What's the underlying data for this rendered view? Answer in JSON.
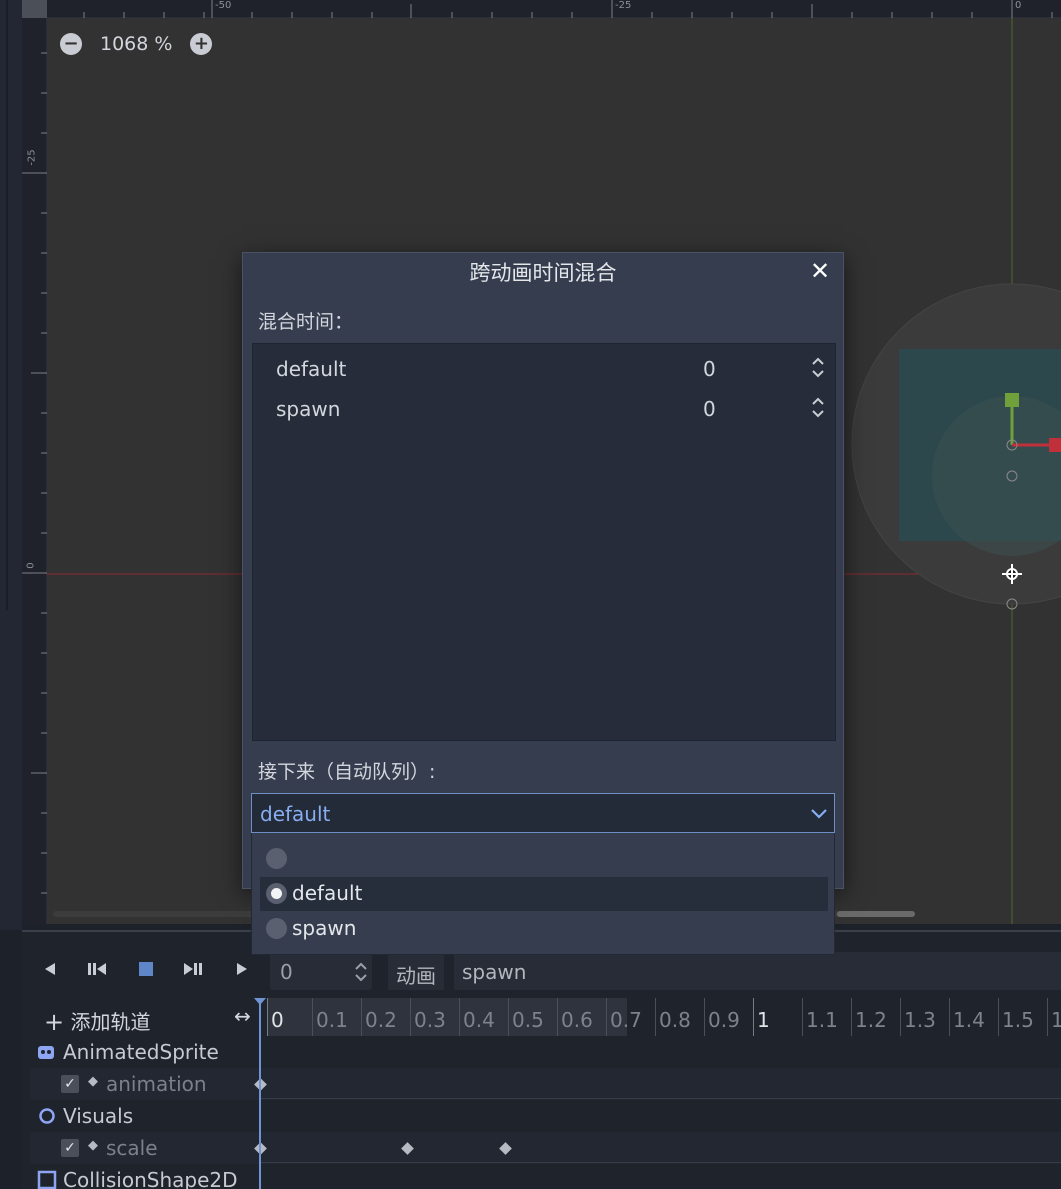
{
  "viewport": {
    "zoom_out_symbol": "−",
    "zoom_level": "1068 %",
    "zoom_in_symbol": "+",
    "ruler_top_labels": [
      "-50",
      "-25",
      "0"
    ],
    "ruler_left_labels": [
      "-25",
      "0"
    ]
  },
  "dialog": {
    "title": "跨动画时间混合",
    "close_symbol": "✕",
    "blend_times_label": "混合时间：",
    "blend_rows": [
      {
        "name": "default",
        "value": "0"
      },
      {
        "name": "spawn",
        "value": "0"
      }
    ],
    "next_label": "接下来（自动队列）:",
    "next_selected": "default",
    "next_options": [
      "",
      "default",
      "spawn"
    ],
    "next_checked_index": 1
  },
  "animation_panel": {
    "frame_value": "0",
    "animation_label": "动画",
    "animation_selected": "spawn",
    "add_track_label": "添加轨道",
    "timeline_ticks": [
      "0",
      "0.1",
      "0.2",
      "0.3",
      "0.4",
      "0.5",
      "0.6",
      "0.7",
      "0.8",
      "0.9",
      "1",
      "1.1",
      "1.2",
      "1.3",
      "1.4",
      "1.5",
      "1"
    ],
    "tracks": [
      {
        "name": "AnimatedSprite",
        "kind": "node"
      },
      {
        "name": "animation",
        "kind": "property"
      },
      {
        "name": "Visuals",
        "kind": "node"
      },
      {
        "name": "scale",
        "kind": "property"
      },
      {
        "name": "CollisionShape2D",
        "kind": "node"
      }
    ]
  },
  "colors": {
    "accent": "#6d8fc4",
    "selected_text": "#86aef0",
    "dialog_bg": "#353d4f",
    "canvas_bg": "#323232",
    "x_axis": "#c0303a",
    "y_axis": "#6fa03a"
  },
  "icons": [
    "zoom-out-icon",
    "zoom-in-icon",
    "close-icon",
    "spinner-icon",
    "chevron-down-icon",
    "radio-icon",
    "play-backward-icon",
    "step-backward-icon",
    "stop-icon",
    "step-forward-icon",
    "play-forward-icon",
    "plus-icon",
    "resize-icon",
    "animated-sprite-icon",
    "node2d-icon",
    "collision-shape-icon",
    "checkbox-icon",
    "keyframe-icon"
  ]
}
